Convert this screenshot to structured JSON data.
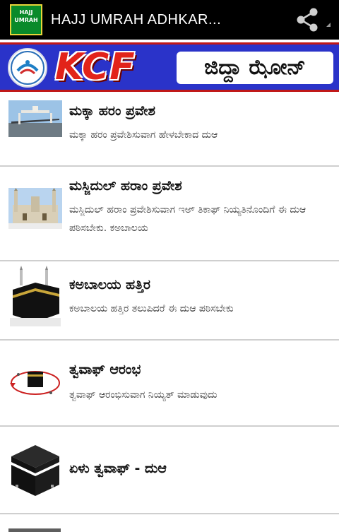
{
  "actionbar": {
    "app_icon_text": "HAJJ UMRAH",
    "title": "HAJJ UMRAH ADHKAR...",
    "share_icon": "share-icon"
  },
  "banner": {
    "logo_icon": "kcf-emblem-logo",
    "kcf_text": "KCF",
    "zone_text": "ಜಿದ್ದಾ ಝೋನ್"
  },
  "items": [
    {
      "title": "ಮಕ್ಕಾ ಹರಂ ಪ್ರವೇಶ",
      "desc": "ಮಕ್ಕಾ ಹರಂ ಪ್ರವೇಶಿಸುವಾಗ ಹೇಳಬೇಕಾದ ದುಆ",
      "thumb": "mecca-gate-thumbnail"
    },
    {
      "title": "ಮಸ್ಜಿದುಲ್ ಹರಾಂ ಪ್ರವೇಶ",
      "desc": "ಮಸ್ಜಿದುಲ್ ಹರಾಂ ಪ್ರವೇಶಿಸುವಾಗ ಇಅ್ ತಿಕಾಫ್ ನಿಯ್ಯತಿನೊಂದಿಗೆ ಈ ದುಆ ಪಠಿಸಬೇಕು. ಕಅಬಾಲಯ",
      "thumb": "masjid-haram-thumbnail"
    },
    {
      "title": "ಕಅಬಾಲಯ ಹತ್ತಿರ",
      "desc": "ಕಅಬಾಲಯ ಹತ್ತಿರ ತಲುಪಿದರೆ ಈ ದುಆ ಪಠಿಸಬೇಕು",
      "thumb": "kaaba-thumbnail"
    },
    {
      "title": "ತ್ವವಾಫ್ ಆರಂಭ",
      "desc": "ತ್ವವಾಫ್ ಆರಂಭಿಸುವಾಗ ನಿಯ್ಯತ್ ಮಾಡುವುದು",
      "thumb": "tawaf-diagram-thumbnail"
    },
    {
      "title": "ಏಳು ತ್ವವಾಫ್ - ದುಆ",
      "desc": "",
      "thumb": "kaaba-icon-thumbnail"
    }
  ]
}
